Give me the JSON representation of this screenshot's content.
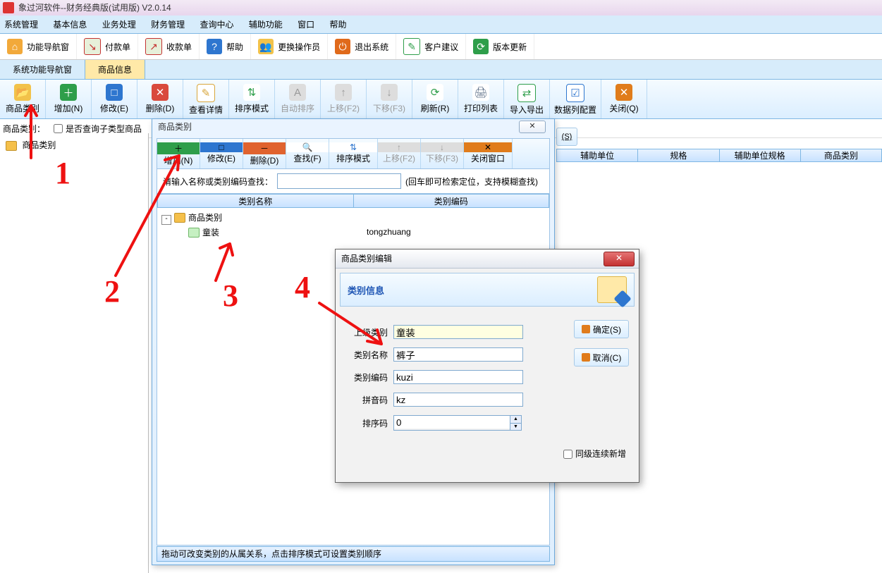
{
  "app": {
    "title": "象过河软件--财务经典版(试用版) V2.0.14"
  },
  "menu": [
    "系统管理",
    "基本信息",
    "业务处理",
    "财务管理",
    "查询中心",
    "辅助功能",
    "窗口",
    "帮助"
  ],
  "toolbar": [
    {
      "label": "功能导航窗",
      "icon": "home",
      "color": "#f2a93a"
    },
    {
      "label": "付款单",
      "icon": "pay",
      "color": "#c43131"
    },
    {
      "label": "收款单",
      "icon": "recv",
      "color": "#c43131"
    },
    {
      "label": "帮助",
      "icon": "help",
      "color": "#2e76cf"
    },
    {
      "label": "更换操作员",
      "icon": "user",
      "color": "#7846b5"
    },
    {
      "label": "退出系统",
      "icon": "exit",
      "color": "#e06a1b"
    },
    {
      "label": "客户建议",
      "icon": "note",
      "color": "#2e9e4a"
    },
    {
      "label": "版本更新",
      "icon": "update",
      "color": "#2e9e4a"
    }
  ],
  "tabs": {
    "items": [
      "系统功能导航窗",
      "商品信息"
    ],
    "active": 1
  },
  "bigtool": [
    {
      "label": "商品类别",
      "color": "#f2c24a",
      "glyph": "📁"
    },
    {
      "label": "增加(N)",
      "color": "#2e9e4a",
      "glyph": "＋"
    },
    {
      "label": "修改(E)",
      "color": "#2e76cf",
      "glyph": "□"
    },
    {
      "label": "删除(D)",
      "color": "#d94a3c",
      "glyph": "✕"
    },
    {
      "label": "查看详情",
      "color": "#d8a63b",
      "glyph": "✎"
    },
    {
      "label": "排序模式",
      "color": "#2e9e4a",
      "glyph": "⇅"
    },
    {
      "label": "自动排序",
      "color": "#b7b7b7",
      "glyph": "A",
      "dis": true
    },
    {
      "label": "上移(F2)",
      "color": "#b7b7b7",
      "glyph": "↑",
      "dis": true
    },
    {
      "label": "下移(F3)",
      "color": "#b7b7b7",
      "glyph": "↓",
      "dis": true
    },
    {
      "label": "刷新(R)",
      "color": "#2e9e4a",
      "glyph": "⟳"
    },
    {
      "label": "打印列表",
      "color": "#5a6c85",
      "glyph": "🖨"
    },
    {
      "label": "导入导出",
      "color": "#2e9e4a",
      "glyph": "⇄"
    },
    {
      "label": "数据列配置",
      "color": "#2e76cf",
      "glyph": "☑",
      "wide": true
    },
    {
      "label": "关闭(Q)",
      "color": "#e07c1b",
      "glyph": "✕"
    }
  ],
  "filter": {
    "label": "商品类别：",
    "checkbox": "是否查询子类型商品"
  },
  "side": {
    "root": "商品类别"
  },
  "sbtn": "(S)",
  "maincols": [
    "辅助单位",
    "规格",
    "辅助单位规格",
    "商品类别"
  ],
  "modal": {
    "title": "商品类别",
    "close_glyph": "✕",
    "tool": [
      {
        "label": "增加(N)",
        "color": "#2e9e4a",
        "glyph": "＋"
      },
      {
        "label": "修改(E)",
        "color": "#2e76cf",
        "glyph": "□"
      },
      {
        "label": "删除(D)",
        "color": "#e0632e",
        "glyph": "－"
      },
      {
        "label": "查找(F)",
        "color": "#e0b92e",
        "glyph": "🔍"
      },
      {
        "label": "排序模式",
        "color": "#2e76cf",
        "glyph": "⇅",
        "wide": true
      },
      {
        "label": "上移(F2)",
        "color": "#b7b7b7",
        "glyph": "↑",
        "dis": true
      },
      {
        "label": "下移(F3)",
        "color": "#b7b7b7",
        "glyph": "↓",
        "dis": true
      },
      {
        "label": "关闭窗口",
        "color": "#e07c1b",
        "glyph": "✕",
        "wide": true
      }
    ],
    "search_label": "请输入名称或类别编码查找：",
    "search_hint": "(回车即可检索定位，支持模糊查找)",
    "search_value": "",
    "cols": [
      "类别名称",
      "类别编码"
    ],
    "rows": [
      {
        "name": "商品类别",
        "code": "",
        "level": 0,
        "folder": true,
        "tw": "-"
      },
      {
        "name": "童装",
        "code": "tongzhuang",
        "level": 1,
        "folder": false
      }
    ],
    "footer": "拖动可改变类别的从属关系，点击排序模式可设置类别顺序"
  },
  "dlg": {
    "title": "商品类别编辑",
    "head": "类别信息",
    "fields": {
      "parent_label": "上级类别",
      "parent_value": "童装",
      "name_label": "类别名称",
      "name_value": "裤子",
      "code_label": "类别编码",
      "code_value": "kuzi",
      "py_label": "拼音码",
      "py_value": "kz",
      "sort_label": "排序码",
      "sort_value": "0"
    },
    "ok": "确定(S)",
    "cancel": "取消(C)",
    "chk": "同级连续新增"
  },
  "ann": {
    "n1": "1",
    "n2": "2",
    "n3": "3",
    "n4": "4"
  }
}
